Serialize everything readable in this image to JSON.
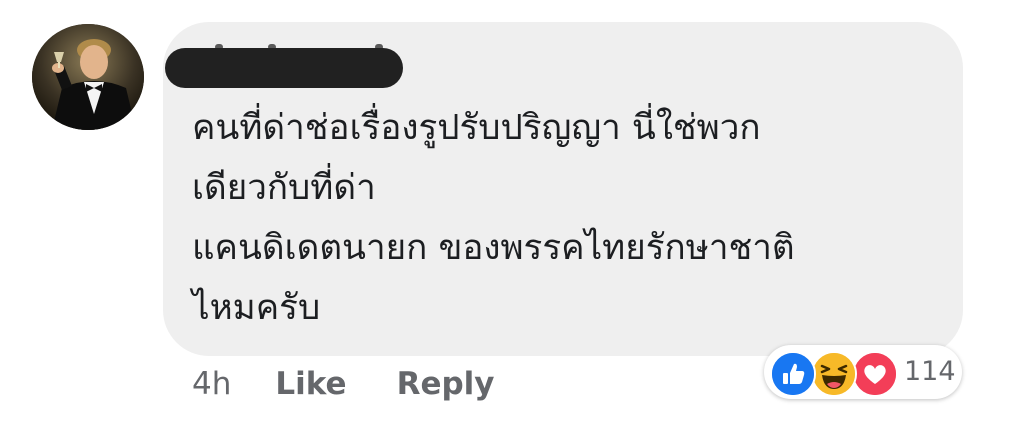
{
  "comment": {
    "lines": [
      "คนที่ด่าช่อเรื่องรูปรับปริญญา นี่ใช่พวก",
      "เดียวกับที่ด่า",
      "แคนดิเดตนายก ของพรรคไทยรักษาชาติ",
      "ไหมครับ"
    ]
  },
  "actions": {
    "time": "4h",
    "like_label": "Like",
    "reply_label": "Reply"
  },
  "reactions": {
    "types": [
      "like-icon",
      "haha-icon",
      "love-icon"
    ],
    "count": "114"
  },
  "colors": {
    "bubble": "#efefef",
    "like_blue": "#1877f2",
    "haha_yellow": "#f7b928",
    "love_red": "#f33e58",
    "meta_gray": "#65676b"
  }
}
